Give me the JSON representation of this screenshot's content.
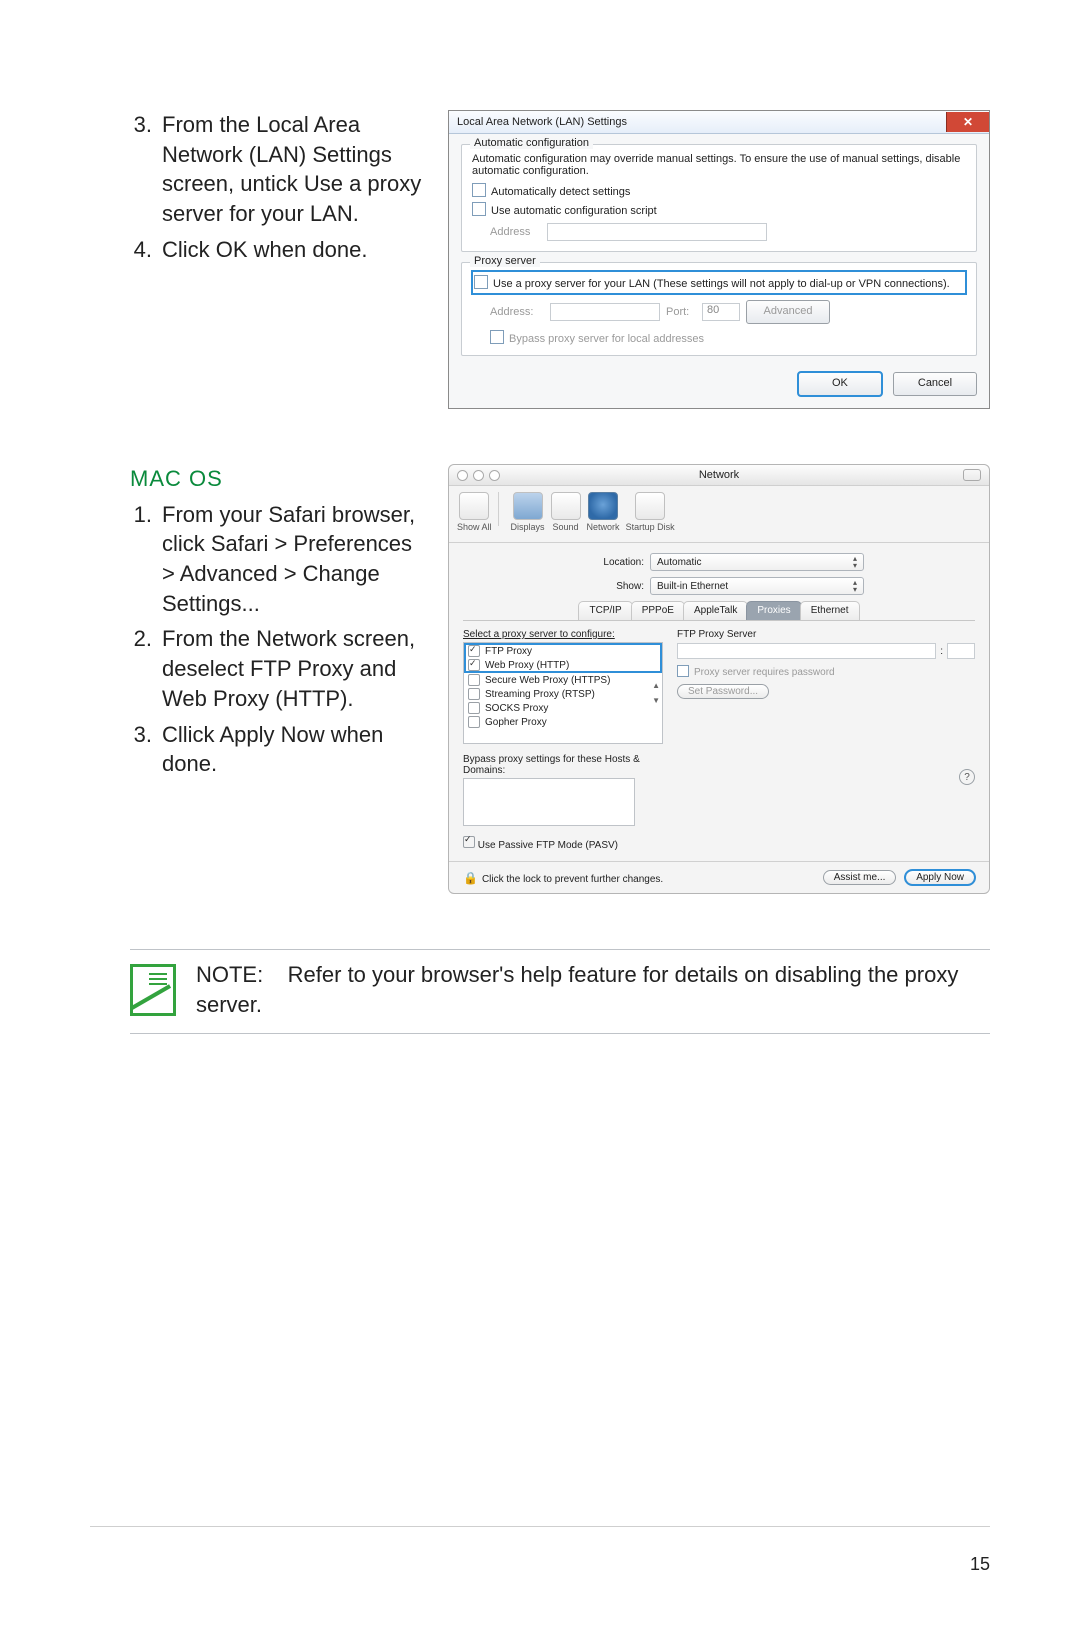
{
  "instructions_top": [
    {
      "num": "3.",
      "text": "From the Local Area Network (LAN) Settings screen, untick Use a proxy server for your LAN."
    },
    {
      "num": "4.",
      "text": "Click OK when done."
    }
  ],
  "macos_heading": "MAC OS",
  "instructions_mac": [
    {
      "num": "1.",
      "text": "From your Safari browser, click Safari > Preferences > Advanced > Change Settings..."
    },
    {
      "num": "2.",
      "text": "From the Network screen, deselect FTP Proxy and Web Proxy (HTTP)."
    },
    {
      "num": "3.",
      "text": "Cllick Apply Now when done."
    }
  ],
  "note_label": "NOTE:",
  "note_text": "Refer to your browser's help feature for details on disabling the proxy server.",
  "page_number": "15",
  "win": {
    "title": "Local Area Network (LAN) Settings",
    "auto_group": "Automatic configuration",
    "auto_desc": "Automatic configuration may override manual settings. To ensure the use of manual settings, disable automatic configuration.",
    "auto_detect": "Automatically detect settings",
    "auto_script": "Use automatic configuration script",
    "address_label": "Address",
    "proxy_group": "Proxy server",
    "proxy_text": "Use a proxy server for your LAN (These settings will not apply to dial-up or VPN connections).",
    "addr_label": "Address:",
    "port_label": "Port:",
    "port_value": "80",
    "advanced": "Advanced",
    "bypass": "Bypass proxy server for local addresses",
    "ok": "OK",
    "cancel": "Cancel"
  },
  "mac": {
    "title": "Network",
    "toolbar": {
      "showall": "Show All",
      "displays": "Displays",
      "sound": "Sound",
      "network": "Network",
      "startup": "Startup Disk"
    },
    "location_lbl": "Location:",
    "location_val": "Automatic",
    "show_lbl": "Show:",
    "show_val": "Built-in Ethernet",
    "tabs": [
      "TCP/IP",
      "PPPoE",
      "AppleTalk",
      "Proxies",
      "Ethernet"
    ],
    "select_proxy": "Select a proxy server to configure:",
    "proxies": {
      "ftp": "FTP Proxy",
      "web": "Web Proxy (HTTP)",
      "secure": "Secure Web Proxy (HTTPS)",
      "stream": "Streaming Proxy (RTSP)",
      "socks": "SOCKS Proxy",
      "gopher": "Gopher Proxy"
    },
    "right_header": "FTP Proxy Server",
    "requires_pw": "Proxy server requires password",
    "set_pw": "Set Password...",
    "bypass_lbl": "Bypass proxy settings for these Hosts & Domains:",
    "pasv": "Use Passive FTP Mode (PASV)",
    "lock_text": "Click the lock to prevent further changes.",
    "assist": "Assist me...",
    "apply": "Apply Now"
  }
}
